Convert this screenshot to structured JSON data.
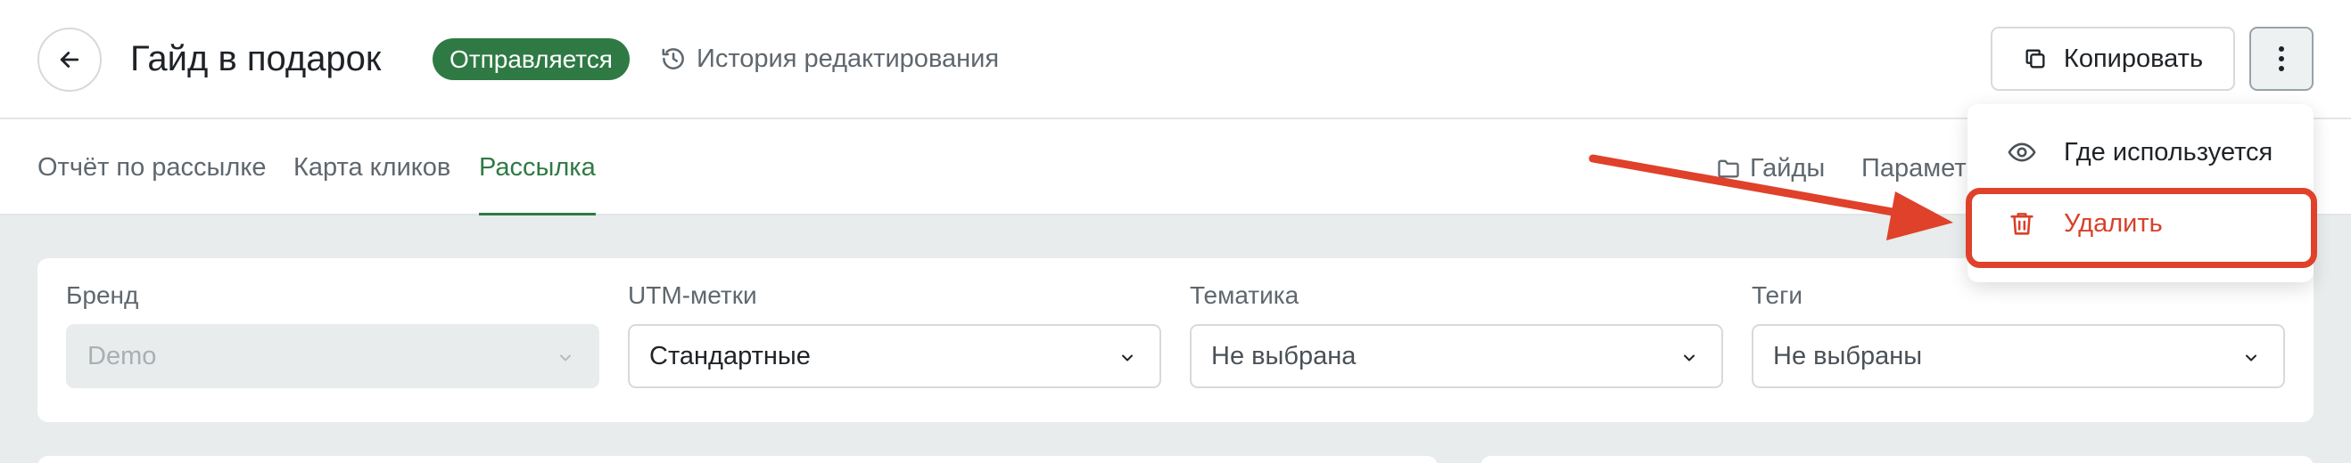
{
  "header": {
    "title": "Гайд в подарок",
    "status": "Отправляется",
    "history_label": "История редактирования",
    "copy_label": "Копировать"
  },
  "tabs": [
    {
      "label": "Отчёт по рассылке",
      "active": false
    },
    {
      "label": "Карта кликов",
      "active": false
    },
    {
      "label": "Рассылка",
      "active": true
    }
  ],
  "right_tabs": {
    "guides_label": "Гайды",
    "params_label": "Парамет"
  },
  "filters": [
    {
      "label": "Бренд",
      "value": "Demo",
      "disabled": true
    },
    {
      "label": "UTM-метки",
      "value": "Стандартные",
      "disabled": false
    },
    {
      "label": "Тематика",
      "value": "Не выбрана",
      "disabled": false
    },
    {
      "label": "Теги",
      "value": "Не выбраны",
      "disabled": false
    }
  ],
  "menu": {
    "where_used_label": "Где используется",
    "delete_label": "Удалить"
  },
  "colors": {
    "accent": "#2f7a44",
    "danger": "#d8402a",
    "annotation": "#e0412a"
  },
  "icons": {
    "back": "arrow-left-icon",
    "history": "history-clock-icon",
    "copy": "copy-icon",
    "more": "more-vertical-icon",
    "folder": "folder-icon",
    "eye": "eye-icon",
    "trash": "trash-icon",
    "chevron": "chevron-down-icon"
  }
}
